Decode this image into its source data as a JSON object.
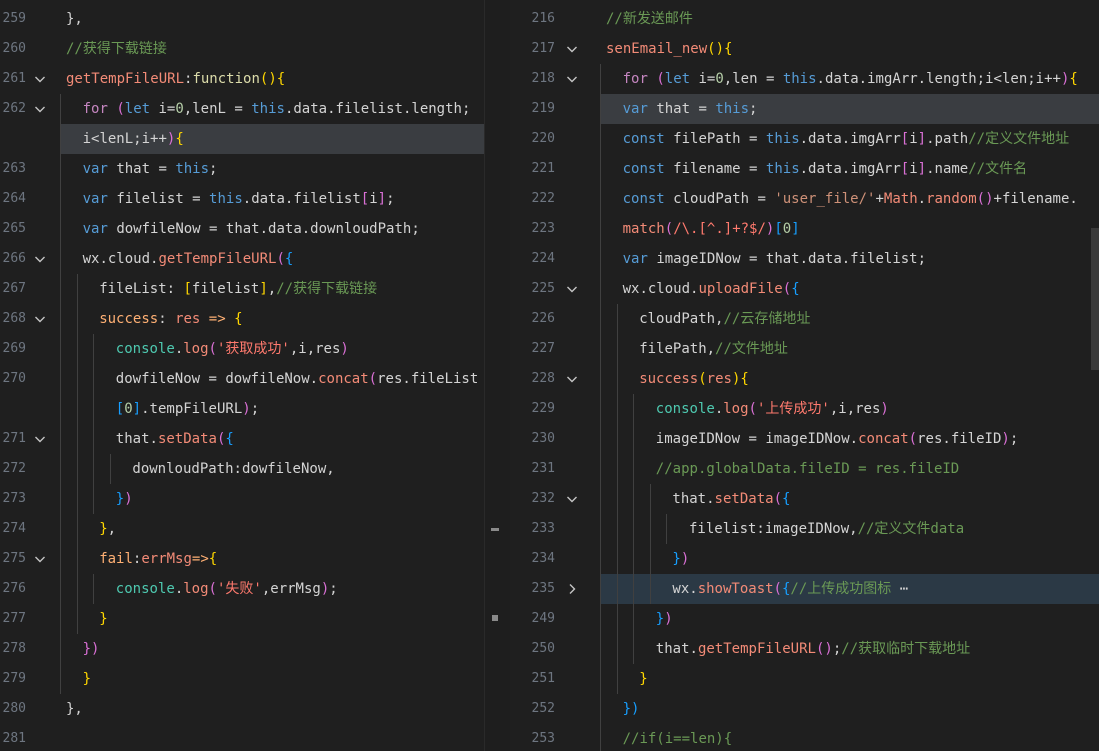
{
  "left": {
    "lines": [
      {
        "n": "259",
        "fold": false,
        "indent": 0,
        "segs": [
          [
            "def",
            "},"
          ]
        ]
      },
      {
        "n": "260",
        "fold": false,
        "indent": 0,
        "segs": [
          [
            "com",
            "//获得下载链接"
          ]
        ]
      },
      {
        "n": "261",
        "fold": true,
        "indent": 0,
        "segs": [
          [
            "fnr",
            "getTempFileURL"
          ],
          [
            "def",
            ":"
          ],
          [
            "fn",
            "function"
          ],
          [
            "br",
            "()"
          ],
          [
            "br",
            "{"
          ]
        ]
      },
      {
        "n": "262",
        "fold": true,
        "indent": 1,
        "segs": [
          [
            "ct",
            "for"
          ],
          [
            "def",
            " "
          ],
          [
            "br2",
            "("
          ],
          [
            "kw",
            "let"
          ],
          [
            "def",
            " i="
          ],
          [
            "num",
            "0"
          ],
          [
            "def",
            ",lenL = "
          ],
          [
            "kw",
            "this"
          ],
          [
            "def",
            ".data.filelist.length;"
          ]
        ]
      },
      {
        "n": "",
        "fold": false,
        "indent": 1,
        "selected": true,
        "segs": [
          [
            "def",
            "i<lenL;i++"
          ],
          [
            "br2",
            ")"
          ],
          [
            "br",
            "{"
          ]
        ]
      },
      {
        "n": "263",
        "fold": false,
        "indent": 1,
        "segs": [
          [
            "kw",
            "var"
          ],
          [
            "def",
            " that = "
          ],
          [
            "kw",
            "this"
          ],
          [
            "def",
            ";"
          ]
        ]
      },
      {
        "n": "264",
        "fold": false,
        "indent": 1,
        "segs": [
          [
            "kw",
            "var"
          ],
          [
            "def",
            " filelist = "
          ],
          [
            "kw",
            "this"
          ],
          [
            "def",
            ".data.filelist"
          ],
          [
            "br2",
            "["
          ],
          [
            "def",
            "i"
          ],
          [
            "br2",
            "]"
          ],
          [
            "def",
            ";"
          ]
        ]
      },
      {
        "n": "265",
        "fold": false,
        "indent": 1,
        "segs": [
          [
            "kw",
            "var"
          ],
          [
            "def",
            " dowfileNow = that.data.downloudPath;"
          ]
        ]
      },
      {
        "n": "266",
        "fold": true,
        "indent": 1,
        "segs": [
          [
            "def",
            "wx.cloud."
          ],
          [
            "fnr",
            "getTempFileURL"
          ],
          [
            "br2",
            "("
          ],
          [
            "br3",
            "{"
          ]
        ]
      },
      {
        "n": "267",
        "fold": false,
        "indent": 2,
        "segs": [
          [
            "def",
            "fileList: "
          ],
          [
            "br",
            "["
          ],
          [
            "def",
            "filelist"
          ],
          [
            "br",
            "]"
          ],
          [
            "def",
            ","
          ],
          [
            "com",
            "//获得下载链接"
          ]
        ]
      },
      {
        "n": "268",
        "fold": true,
        "indent": 2,
        "segs": [
          [
            "prop",
            "success"
          ],
          [
            "def",
            ": "
          ],
          [
            "fnr",
            "res"
          ],
          [
            "def",
            " "
          ],
          [
            "prop",
            "=>"
          ],
          [
            "def",
            " "
          ],
          [
            "br",
            "{"
          ]
        ]
      },
      {
        "n": "269",
        "fold": false,
        "indent": 3,
        "segs": [
          [
            "green",
            "console"
          ],
          [
            "def",
            "."
          ],
          [
            "fnr",
            "log"
          ],
          [
            "br2",
            "("
          ],
          [
            "strr",
            "'获取成功'"
          ],
          [
            "def",
            ",i,res"
          ],
          [
            "br2",
            ")"
          ]
        ]
      },
      {
        "n": "270",
        "fold": false,
        "indent": 3,
        "segs": [
          [
            "def",
            "dowfileNow = dowfileNow."
          ],
          [
            "fnr",
            "concat"
          ],
          [
            "br2",
            "("
          ],
          [
            "def",
            "res.fileList"
          ]
        ]
      },
      {
        "n": "",
        "fold": false,
        "indent": 3,
        "segs": [
          [
            "br3",
            "["
          ],
          [
            "num",
            "0"
          ],
          [
            "br3",
            "]"
          ],
          [
            "def",
            ".tempFileURL"
          ],
          [
            "br2",
            ")"
          ],
          [
            "def",
            ";"
          ]
        ]
      },
      {
        "n": "271",
        "fold": true,
        "indent": 3,
        "segs": [
          [
            "def",
            "that."
          ],
          [
            "fnr",
            "setData"
          ],
          [
            "br2",
            "("
          ],
          [
            "br3",
            "{"
          ]
        ]
      },
      {
        "n": "272",
        "fold": false,
        "indent": 4,
        "segs": [
          [
            "def",
            "downloudPath:dowfileNow,"
          ]
        ]
      },
      {
        "n": "273",
        "fold": false,
        "indent": 3,
        "segs": [
          [
            "br3",
            "}"
          ],
          [
            "br2",
            ")"
          ]
        ]
      },
      {
        "n": "274",
        "fold": false,
        "indent": 2,
        "segs": [
          [
            "br",
            "}"
          ],
          [
            "def",
            ","
          ]
        ]
      },
      {
        "n": "275",
        "fold": true,
        "indent": 2,
        "segs": [
          [
            "prop",
            "fail"
          ],
          [
            "def",
            ":"
          ],
          [
            "fnr",
            "errMsg"
          ],
          [
            "prop",
            "=>"
          ],
          [
            "br",
            "{"
          ]
        ]
      },
      {
        "n": "276",
        "fold": false,
        "indent": 3,
        "segs": [
          [
            "green",
            "console"
          ],
          [
            "def",
            "."
          ],
          [
            "fnr",
            "log"
          ],
          [
            "br2",
            "("
          ],
          [
            "strr",
            "'失败'"
          ],
          [
            "def",
            ",errMsg"
          ],
          [
            "br2",
            ")"
          ],
          [
            "def",
            ";"
          ]
        ]
      },
      {
        "n": "277",
        "fold": false,
        "indent": 2,
        "segs": [
          [
            "br",
            "}"
          ]
        ]
      },
      {
        "n": "278",
        "fold": false,
        "indent": 1,
        "segs": [
          [
            "br2",
            "})"
          ]
        ]
      },
      {
        "n": "279",
        "fold": false,
        "indent": 1,
        "segs": [
          [
            "br",
            "}"
          ]
        ]
      },
      {
        "n": "280",
        "fold": false,
        "indent": 0,
        "segs": [
          [
            "def",
            "},"
          ]
        ]
      },
      {
        "n": "281",
        "fold": false,
        "indent": 0,
        "segs": []
      }
    ]
  },
  "right": {
    "lines": [
      {
        "n": "216",
        "fold": false,
        "indent": 0,
        "segs": [
          [
            "com",
            "//新发送邮件"
          ]
        ]
      },
      {
        "n": "217",
        "fold": true,
        "indent": 0,
        "segs": [
          [
            "fnr",
            "senEmail_new"
          ],
          [
            "br",
            "()"
          ],
          [
            "br",
            "{"
          ]
        ]
      },
      {
        "n": "218",
        "fold": true,
        "indent": 1,
        "segs": [
          [
            "ct",
            "for"
          ],
          [
            "def",
            " "
          ],
          [
            "br2",
            "("
          ],
          [
            "kw",
            "let"
          ],
          [
            "def",
            " i="
          ],
          [
            "num",
            "0"
          ],
          [
            "def",
            ",len = "
          ],
          [
            "kw",
            "this"
          ],
          [
            "def",
            ".data.imgArr.length;i<len;i++"
          ],
          [
            "br2",
            ")"
          ],
          [
            "br",
            "{"
          ]
        ]
      },
      {
        "n": "219",
        "fold": false,
        "indent": 1,
        "selected": true,
        "segs": [
          [
            "kw",
            "var"
          ],
          [
            "def",
            " that = "
          ],
          [
            "kw",
            "this"
          ],
          [
            "def",
            ";"
          ]
        ]
      },
      {
        "n": "220",
        "fold": false,
        "indent": 1,
        "segs": [
          [
            "kw",
            "const"
          ],
          [
            "def",
            " filePath = "
          ],
          [
            "kw",
            "this"
          ],
          [
            "def",
            ".data.imgArr"
          ],
          [
            "br2",
            "["
          ],
          [
            "def",
            "i"
          ],
          [
            "br2",
            "]"
          ],
          [
            "def",
            ".path"
          ],
          [
            "com",
            "//定义文件地址"
          ]
        ]
      },
      {
        "n": "221",
        "fold": false,
        "indent": 1,
        "segs": [
          [
            "kw",
            "const"
          ],
          [
            "def",
            " filename = "
          ],
          [
            "kw",
            "this"
          ],
          [
            "def",
            ".data.imgArr"
          ],
          [
            "br2",
            "["
          ],
          [
            "def",
            "i"
          ],
          [
            "br2",
            "]"
          ],
          [
            "def",
            ".name"
          ],
          [
            "com",
            "//文件名"
          ]
        ]
      },
      {
        "n": "222",
        "fold": false,
        "indent": 1,
        "segs": [
          [
            "kw",
            "const"
          ],
          [
            "def",
            " cloudPath = "
          ],
          [
            "str",
            "'user_file/'"
          ],
          [
            "def",
            "+"
          ],
          [
            "fnr",
            "Math"
          ],
          [
            "def",
            "."
          ],
          [
            "fnr",
            "random"
          ],
          [
            "br2",
            "()"
          ],
          [
            "def",
            "+filename."
          ]
        ]
      },
      {
        "n": "223",
        "fold": false,
        "indent": 1,
        "segs": [
          [
            "fnr",
            "match"
          ],
          [
            "br2",
            "("
          ],
          [
            "strr",
            "/\\.[^.]+?$/"
          ],
          [
            "br2",
            ")"
          ],
          [
            "br3",
            "["
          ],
          [
            "num",
            "0"
          ],
          [
            "br3",
            "]"
          ]
        ]
      },
      {
        "n": "224",
        "fold": false,
        "indent": 1,
        "segs": [
          [
            "kw",
            "var"
          ],
          [
            "def",
            " imageIDNow = that.data.filelist;"
          ]
        ]
      },
      {
        "n": "225",
        "fold": true,
        "indent": 1,
        "segs": [
          [
            "def",
            "wx.cloud."
          ],
          [
            "fnr",
            "uploadFile"
          ],
          [
            "br2",
            "("
          ],
          [
            "br3",
            "{"
          ]
        ]
      },
      {
        "n": "226",
        "fold": false,
        "indent": 2,
        "segs": [
          [
            "def",
            "cloudPath,"
          ],
          [
            "com",
            "//云存储地址"
          ]
        ]
      },
      {
        "n": "227",
        "fold": false,
        "indent": 2,
        "segs": [
          [
            "def",
            "filePath,"
          ],
          [
            "com",
            "//文件地址"
          ]
        ]
      },
      {
        "n": "228",
        "fold": true,
        "indent": 2,
        "segs": [
          [
            "fnr",
            "success"
          ],
          [
            "br",
            "("
          ],
          [
            "fnr",
            "res"
          ],
          [
            "br",
            ")"
          ],
          [
            "br",
            "{"
          ]
        ]
      },
      {
        "n": "229",
        "fold": false,
        "indent": 3,
        "segs": [
          [
            "green",
            "console"
          ],
          [
            "def",
            "."
          ],
          [
            "fnr",
            "log"
          ],
          [
            "br2",
            "("
          ],
          [
            "strr",
            "'上传成功'"
          ],
          [
            "def",
            ",i,res"
          ],
          [
            "br2",
            ")"
          ]
        ]
      },
      {
        "n": "230",
        "fold": false,
        "indent": 3,
        "segs": [
          [
            "def",
            "imageIDNow = imageIDNow."
          ],
          [
            "fnr",
            "concat"
          ],
          [
            "br2",
            "("
          ],
          [
            "def",
            "res.fileID"
          ],
          [
            "br2",
            ")"
          ],
          [
            "def",
            ";"
          ]
        ]
      },
      {
        "n": "231",
        "fold": false,
        "indent": 3,
        "segs": [
          [
            "com",
            "//app.globalData.fileID = res.fileID"
          ]
        ]
      },
      {
        "n": "232",
        "fold": true,
        "indent": 4,
        "segs": [
          [
            "def",
            "that."
          ],
          [
            "fnr",
            "setData"
          ],
          [
            "br2",
            "("
          ],
          [
            "br3",
            "{"
          ]
        ]
      },
      {
        "n": "233",
        "fold": false,
        "indent": 5,
        "segs": [
          [
            "def",
            "filelist:imageIDNow,"
          ],
          [
            "com",
            "//定义文件data"
          ]
        ]
      },
      {
        "n": "234",
        "fold": false,
        "indent": 4,
        "segs": [
          [
            "br3",
            "}"
          ],
          [
            "br2",
            ")"
          ]
        ]
      },
      {
        "n": "235",
        "fold": "closed",
        "indent": 4,
        "highlight": true,
        "segs": [
          [
            "def",
            "wx."
          ],
          [
            "fnr",
            "showToast"
          ],
          [
            "br2",
            "("
          ],
          [
            "br3",
            "{"
          ],
          [
            "com",
            "//上传成功图标"
          ],
          [
            "def",
            " ⋯"
          ]
        ]
      },
      {
        "n": "249",
        "fold": false,
        "indent": 3,
        "segs": [
          [
            "br3",
            "}"
          ],
          [
            "br2",
            ")"
          ]
        ]
      },
      {
        "n": "250",
        "fold": false,
        "indent": 3,
        "segs": [
          [
            "def",
            "that."
          ],
          [
            "fnr",
            "getTempFileURL"
          ],
          [
            "br2",
            "()"
          ],
          [
            "def",
            ";"
          ],
          [
            "com",
            "//获取临时下载地址"
          ]
        ]
      },
      {
        "n": "251",
        "fold": false,
        "indent": 2,
        "segs": [
          [
            "br",
            "}"
          ]
        ]
      },
      {
        "n": "252",
        "fold": false,
        "indent": 1,
        "segs": [
          [
            "br3",
            "})"
          ]
        ]
      },
      {
        "n": "253",
        "fold": false,
        "indent": 1,
        "segs": [
          [
            "com",
            "//if(i==len){"
          ]
        ]
      }
    ]
  },
  "icons": {
    "fold_open": "chevron-down-icon",
    "fold_closed": "chevron-right-icon"
  }
}
